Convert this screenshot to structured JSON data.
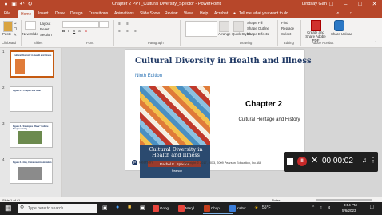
{
  "window": {
    "title": "Chapter 2 PPT_Cultural Diversity_Spector - PowerPoint",
    "user": "Lindsay Gan"
  },
  "tabs": [
    "File",
    "Home",
    "Insert",
    "Draw",
    "Design",
    "Transitions",
    "Animations",
    "Slide Show",
    "Review",
    "View",
    "Help",
    "Acrobat"
  ],
  "active_tab": "Home",
  "tell_me": "Tell me what you want to do",
  "ribbon": {
    "paste": "Paste",
    "new_slide": "New Slide",
    "layout": "Layout",
    "reset": "Reset",
    "section": "Section",
    "arrange": "Arrange",
    "quick_styles": "Quick Styles",
    "shape_fill": "Shape Fill",
    "shape_outline": "Shape Outline",
    "shape_effects": "Shape Effects",
    "find": "Find",
    "replace": "Replace",
    "select": "Select",
    "create_share": "Create and Share Adobe PDF",
    "share_upload": "Share Upload",
    "groups": {
      "clipboard": "Clipboard",
      "slides": "Slides",
      "font": "Font",
      "paragraph": "Paragraph",
      "drawing": "Drawing",
      "editing": "Editing",
      "adobe": "Adobe Acrobat"
    }
  },
  "thumbnails": [
    {
      "num": "1",
      "title": "Cultural Diversity in Health and Illness",
      "selected": true
    },
    {
      "num": "2",
      "title": "Figure 2-1 Chapter title slide"
    },
    {
      "num": "3",
      "title": "Figure 2-2 Examples \"Race\" Culture Peoples Being"
    },
    {
      "num": "4",
      "title": "Figure 2-3 Hay, Chinatown/Assimilation"
    }
  ],
  "slide": {
    "title": "Cultural Diversity in Health and Illness",
    "edition": "Ninth Edition",
    "cover_title": "Cultural Diversity in Health and Illness",
    "cover_author": "Rachel E. Spector",
    "cover_publisher": "Pearson",
    "chapter": "Chapter 2",
    "chapter_sub": "Cultural Heritage and History",
    "publisher": "Pearson",
    "copyright": "Copyright © 2017, 2013, 2009 Pearson Education, Inc. All"
  },
  "recorder": {
    "time": "00:00:02"
  },
  "status": {
    "slide_of": "Slide 1 of 41",
    "notes": "Notes"
  },
  "taskbar": {
    "search_placeholder": "Type here to search",
    "apps": [
      "Goog...",
      "Maryl...",
      "Chap...",
      "Kaltur..."
    ],
    "weather": "55°F",
    "time": "3:54 PM",
    "date": "5/6/2023"
  },
  "colors": {
    "accent": "#b7472a",
    "title_blue": "#1f3864",
    "sub_blue": "#2e75b6"
  }
}
